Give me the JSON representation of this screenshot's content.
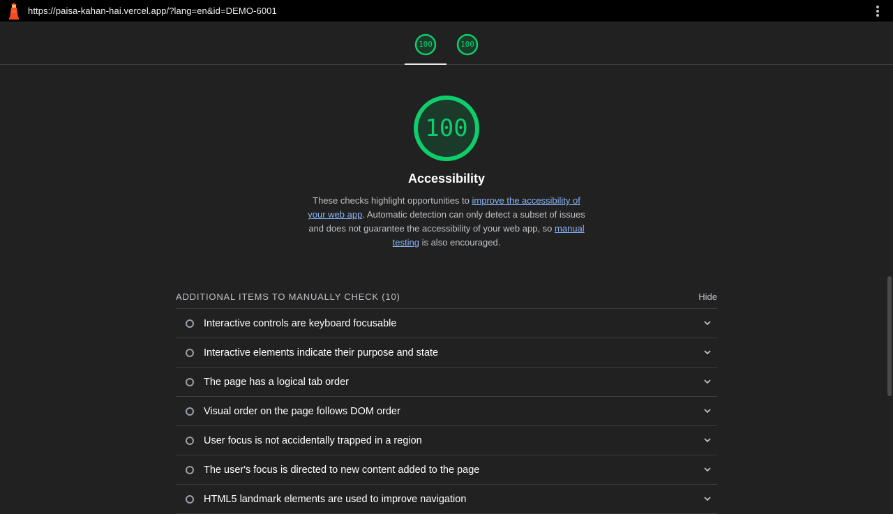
{
  "topbar": {
    "url": "https://paisa-kahan-hai.vercel.app/?lang=en&id=DEMO-6001",
    "logo_icon": "lighthouse-icon",
    "menu_icon": "more-vert-icon"
  },
  "tabs": [
    {
      "score": "100",
      "active": true
    },
    {
      "score": "100",
      "active": false
    }
  ],
  "category": {
    "score": "100",
    "title": "Accessibility",
    "desc_part1": "These checks highlight opportunities to ",
    "desc_link1": "improve the accessibility of your web app",
    "desc_part2": ". Automatic detection can only detect a subset of issues and does not guarantee the accessibility of your web app, so ",
    "desc_link2": "manual testing",
    "desc_part3": " is also encouraged."
  },
  "manual_group": {
    "title": "ADDITIONAL ITEMS TO MANUALLY CHECK (10)",
    "hide_label": "Hide",
    "items": [
      "Interactive controls are keyboard focusable",
      "Interactive elements indicate their purpose and state",
      "The page has a logical tab order",
      "Visual order on the page follows DOM order",
      "User focus is not accidentally trapped in a region",
      "The user's focus is directed to new content added to the page",
      "HTML5 landmark elements are used to improve navigation"
    ]
  },
  "colors": {
    "pass": "#0cce6b",
    "background": "#212121",
    "link": "#8ab4f8"
  }
}
